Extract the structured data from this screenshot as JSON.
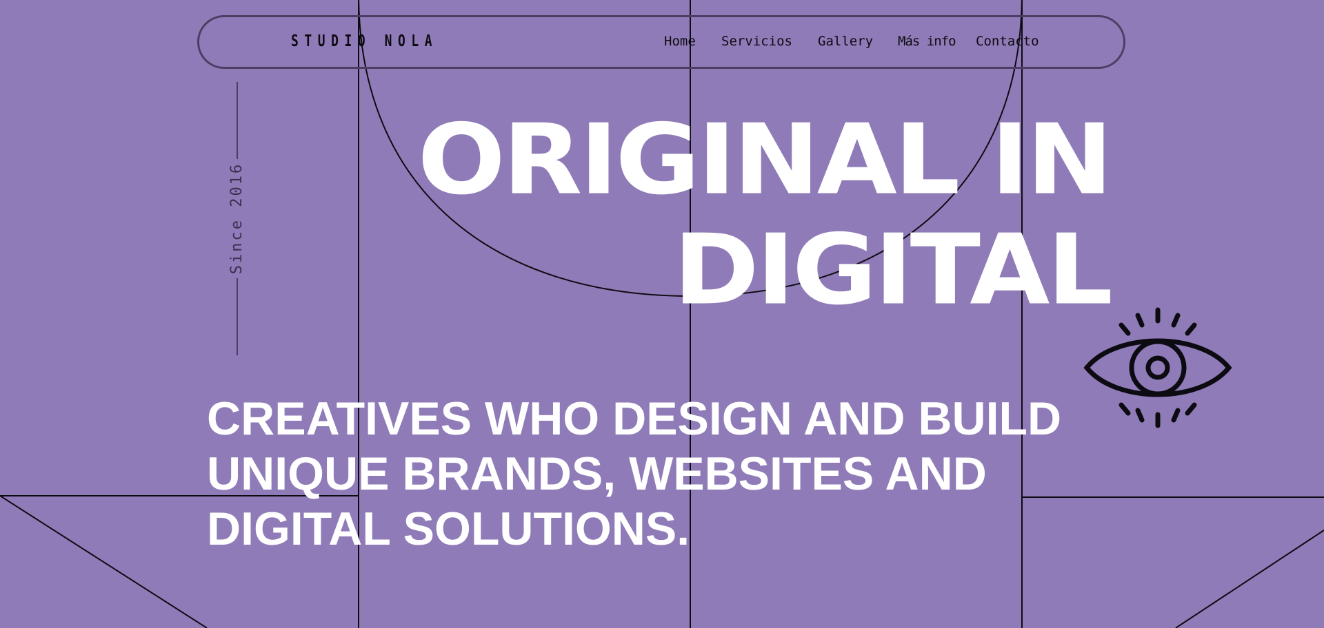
{
  "nav": {
    "brand": "STUDIO NOLA",
    "items": [
      {
        "label": "Home"
      },
      {
        "label": "Servicios"
      },
      {
        "label": "Gallery"
      },
      {
        "label": "Más info"
      },
      {
        "label": "Contacto"
      }
    ]
  },
  "side": {
    "since": "Since 2016"
  },
  "hero": {
    "headline_line1": "ORIGINAL IN",
    "headline_line2": "DIGITAL",
    "tagline": "CREATIVES WHO DESIGN AND BUILD UNIQUE BRANDS, WEBSITES AND DIGITAL SOLUTIONS."
  },
  "icons": {
    "eye": "eye-icon"
  },
  "colors": {
    "background": "#8f7bb7",
    "text_primary": "#ffffff",
    "line_art": "#0d0b12",
    "nav_border": "#4b3e62"
  }
}
